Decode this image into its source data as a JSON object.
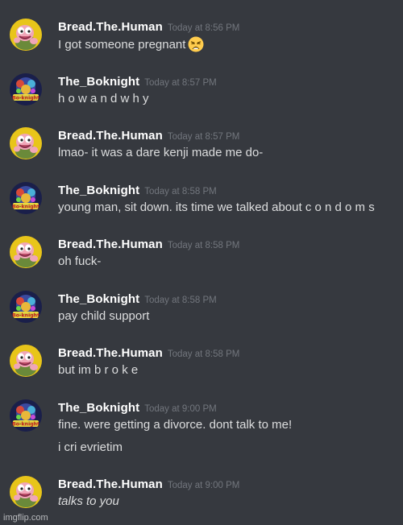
{
  "users": {
    "bread": {
      "name": "Bread.The.Human",
      "avatar_icon": "pink-creature-avatar-icon",
      "avatar_bg": "#e8c51a"
    },
    "boknight": {
      "name": "The_Boknight",
      "avatar_icon": "bo-knight-logo-avatar-icon",
      "avatar_bg": "#1a1f4a",
      "avatar_text": "Bo-knight"
    }
  },
  "messages": [
    {
      "user": "Bread.The.Human",
      "time": "Today at 8:56 PM",
      "lines": [
        "I got someone pregnant"
      ],
      "emoji": "weary-face-emoji-icon"
    },
    {
      "user": "The_Boknight",
      "time": "Today at 8:57 PM",
      "lines": [
        "h o w a n d w h y"
      ]
    },
    {
      "user": "Bread.The.Human",
      "time": "Today at 8:57 PM",
      "lines": [
        "lmao- it was a dare kenji made me do-"
      ]
    },
    {
      "user": "The_Boknight",
      "time": "Today at 8:58 PM",
      "lines": [
        "young man, sit down. its time we talked about c o n d o m s"
      ]
    },
    {
      "user": "Bread.The.Human",
      "time": "Today at 8:58 PM",
      "lines": [
        "oh fuck-"
      ]
    },
    {
      "user": "The_Boknight",
      "time": "Today at 8:58 PM",
      "lines": [
        "pay child support"
      ]
    },
    {
      "user": "Bread.The.Human",
      "time": "Today at 8:58 PM",
      "lines": [
        "but im b r o k e"
      ]
    },
    {
      "user": "The_Boknight",
      "time": "Today at 9:00 PM",
      "lines": [
        "fine. were getting a divorce. dont talk to me!",
        "i cri evrietim"
      ]
    },
    {
      "user": "Bread.The.Human",
      "time": "Today at 9:00 PM",
      "lines": [
        "talks to you"
      ],
      "italic": true
    }
  ],
  "watermark": "imgflip.com",
  "colors": {
    "background": "#36393f",
    "username": "#ffffff",
    "timestamp": "#72767d",
    "text": "#dcddde"
  }
}
